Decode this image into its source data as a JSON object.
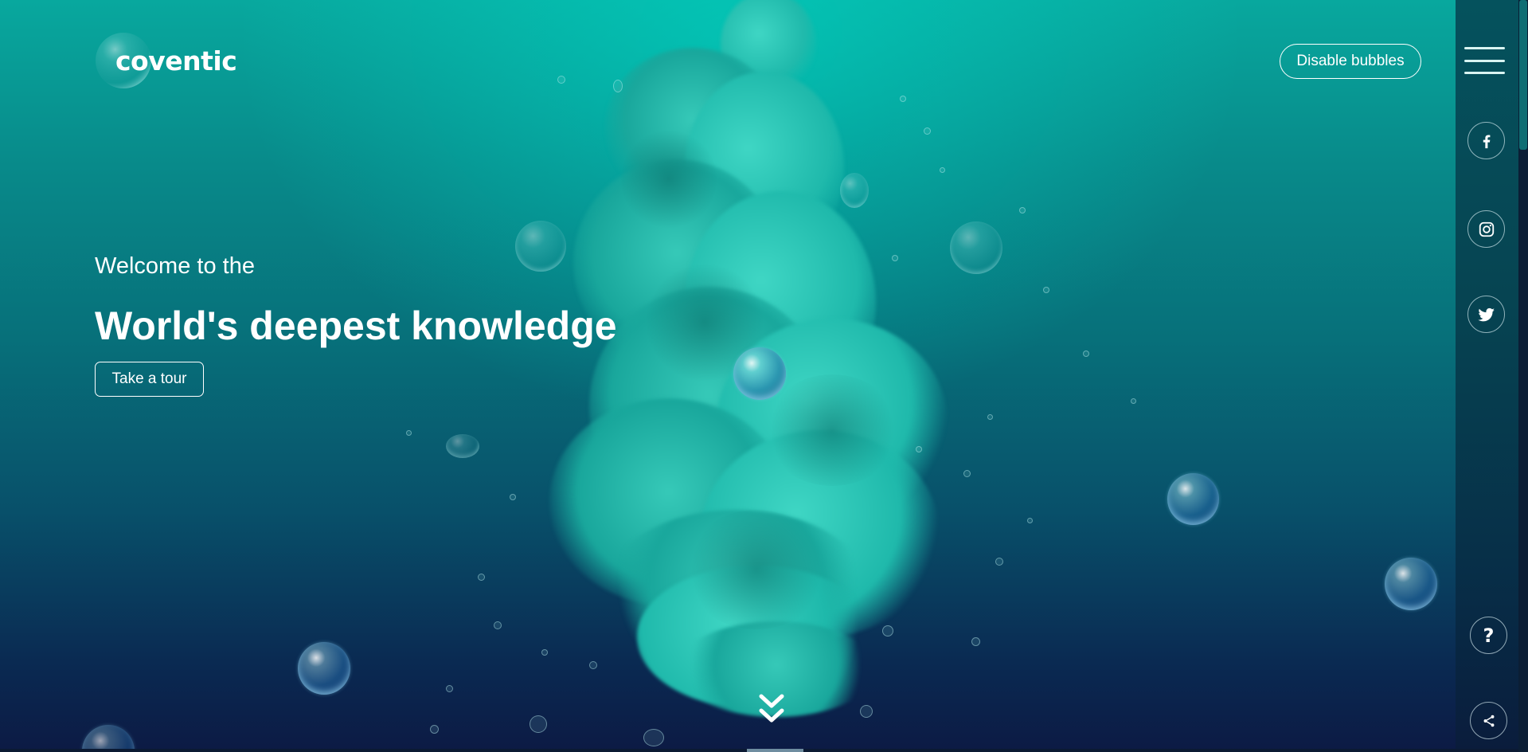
{
  "header": {
    "logo_text": "coventic",
    "disable_bubbles_label": "Disable bubbles"
  },
  "hero": {
    "welcome_text": "Welcome to the",
    "headline": "World's deepest knowledge",
    "tour_button_label": "Take a tour"
  },
  "rail": {
    "menu_icon": "hamburger-menu-icon",
    "social": [
      {
        "name": "facebook",
        "icon": "facebook-icon"
      },
      {
        "name": "instagram",
        "icon": "instagram-icon"
      },
      {
        "name": "twitter",
        "icon": "twitter-icon"
      }
    ],
    "help_label": "?",
    "share_icon": "share-icon"
  },
  "colors": {
    "accent_teal": "#1fb9ab",
    "rail_background": "#064452",
    "text": "#ffffff"
  }
}
